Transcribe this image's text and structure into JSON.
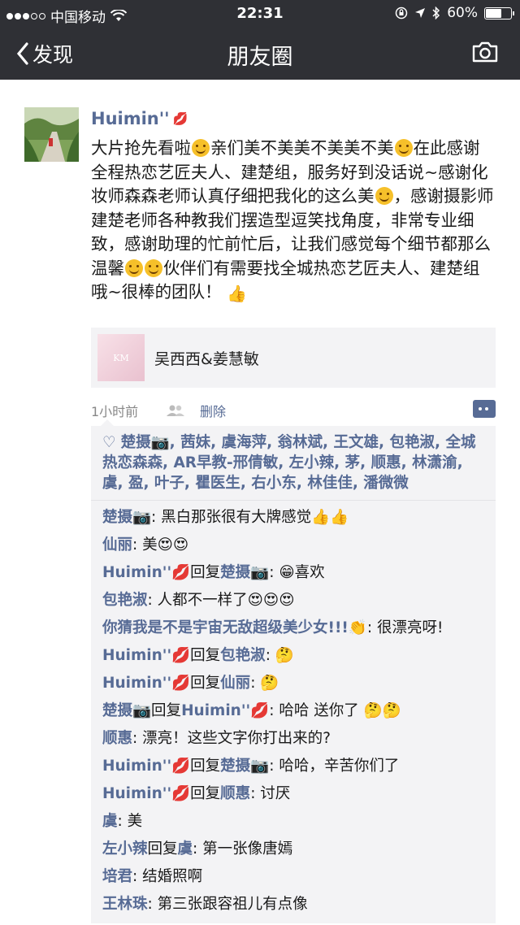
{
  "status_bar": {
    "carrier": "中国移动",
    "time": "22:31",
    "battery": "60%"
  },
  "nav": {
    "back_label": "发现",
    "title": "朋友圈"
  },
  "post": {
    "author": "Huimin''",
    "text_parts": [
      "大片抢先看啦",
      "亲们美不美美不美美不美",
      "在此感谢全程热恋艺匠夫人、建楚组，服务好到没话说~感谢化妆师森森老师认真仔细把我化的这么美",
      "，感谢摄影师建楚老师各种教我们摆造型逗笑找角度，非常专业细致，感谢助理的忙前忙后，让我们感觉每个细节都那么温馨",
      "伙伴们有需要找全城热恋艺匠夫人、建楚组哦~很棒的团队！"
    ],
    "link_title": "吴西西&姜慧敏",
    "link_thumb_text": "KM",
    "time": "1小时前",
    "delete_label": "删除",
    "likes": "楚摄📷, 茜妹, 虞海萍, 翁林斌, 王文雄, 包艳淑, 全城热恋森森, AR早教-邢倩敏, 左小辣, 茅, 顺惠, 林潇渝, 虞, 盈, 叶子, 瞿医生, 右小东, 林佳佳, 潘微微"
  },
  "comments": [
    {
      "name": "楚摄📷",
      "text": ": 黑白那张很有大牌感觉👍👍"
    },
    {
      "name": "仙丽",
      "text": ": 美😍😍"
    },
    {
      "name": "Huimin''💋",
      "reply": "回复",
      "to": "楚摄📷",
      "text": ": 😁喜欢"
    },
    {
      "name": "包艳淑",
      "text": ": 人都不一样了😍😍😍"
    },
    {
      "name": "你猜我是不是宇宙无敌超级美少女!!!👏",
      "text": ": 很漂亮呀!"
    },
    {
      "name": "Huimin''💋",
      "reply": "回复",
      "to": "包艳淑",
      "text": ": 🤔"
    },
    {
      "name": "Huimin''💋",
      "reply": "回复",
      "to": "仙丽",
      "text": ": 🤔"
    },
    {
      "name": "楚摄📷",
      "reply": "回复",
      "to": "Huimin''💋",
      "text": ": 哈哈 送你了 🤔🤔"
    },
    {
      "name": "顺惠",
      "text": ": 漂亮！这些文字你打出来的?"
    },
    {
      "name": "Huimin''💋",
      "reply": "回复",
      "to": "楚摄📷",
      "text": ": 哈哈，辛苦你们了"
    },
    {
      "name": "Huimin''💋",
      "reply": "回复",
      "to": "顺惠",
      "text": ": 讨厌"
    },
    {
      "name": "虞",
      "text": ": 美"
    },
    {
      "name": "左小辣",
      "reply": "回复",
      "to": "虞",
      "text": ": 第一张像唐嫣"
    },
    {
      "name": "培君",
      "text": ": 结婚照啊"
    },
    {
      "name": "王林珠",
      "text": ": 第三张跟容祖儿有点像"
    }
  ]
}
